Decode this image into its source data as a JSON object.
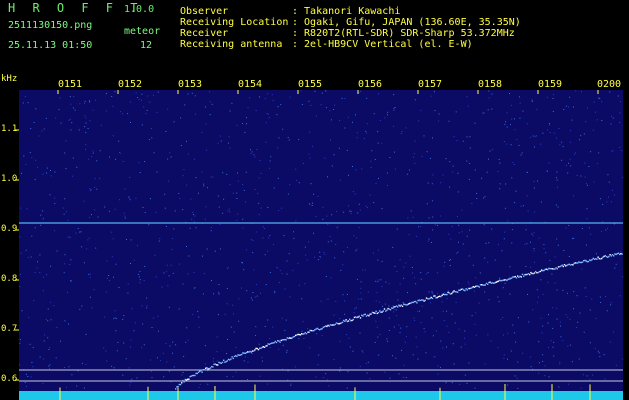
{
  "app": {
    "logo": "H R O F F T",
    "version": "1.0.0"
  },
  "file": {
    "name": "2511130150.png",
    "datetime": "25.11.13 01:50"
  },
  "meteor": {
    "label": "meteor",
    "count": "12"
  },
  "info": [
    {
      "key": "Observer",
      "value": ": Takanori Kawachi"
    },
    {
      "key": "Receiving Location",
      "value": ": Ogaki, Gifu, JAPAN (136.60E, 35.35N)"
    },
    {
      "key": "Receiver",
      "value": ": R820T2(RTL-SDR) SDR-Sharp 53.372MHz"
    },
    {
      "key": "Receiving antenna",
      "value": ": 2el-HB9CV Vertical (el. E-W)"
    }
  ],
  "axis": {
    "y_unit": "kHz",
    "x_ticks": [
      "0151",
      "0152",
      "0153",
      "0154",
      "0155",
      "0156",
      "0157",
      "0158",
      "0159",
      "0200"
    ],
    "y_ticks": [
      "1.1",
      "1.0",
      "0.9",
      "0.8",
      "0.7",
      "0.6"
    ]
  },
  "colors": {
    "background": "#0b0b66",
    "signal": "#8ad8ff",
    "text": "#ffff40",
    "header_text": "#7cfc7c"
  }
}
